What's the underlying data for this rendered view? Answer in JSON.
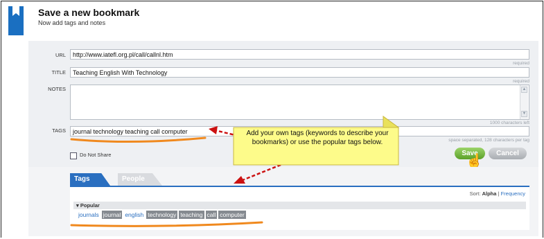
{
  "header": {
    "title": "Save a new bookmark",
    "subtitle": "Now add tags and notes"
  },
  "form": {
    "url": {
      "label": "URL",
      "value": "http://www.iatefl.org.pl/call/callnl.htm",
      "hint": "required"
    },
    "title": {
      "label": "TITLE",
      "value": "Teaching English With Technology",
      "hint": "required"
    },
    "notes": {
      "label": "NOTES",
      "value": "",
      "hint": "1000 characters left"
    },
    "tags": {
      "label": "TAGS",
      "value": "journal technology teaching call computer",
      "hint": "space separated, 128 characters per tag"
    },
    "do_not_share": {
      "label": "Do Not Share",
      "checked": false
    },
    "save_label": "Save",
    "cancel_label": "Cancel"
  },
  "tabs": [
    {
      "label": "Tags",
      "active": true
    },
    {
      "label": "People",
      "active": false
    }
  ],
  "sort": {
    "prefix": "Sort:",
    "alpha": "Alpha",
    "separator": "|",
    "frequency": "Frequency"
  },
  "popular": {
    "heading": "Popular",
    "tags": [
      {
        "label": "journals",
        "selected": false
      },
      {
        "label": "journal",
        "selected": true
      },
      {
        "label": "english",
        "selected": false
      },
      {
        "label": "technology",
        "selected": true
      },
      {
        "label": "teaching",
        "selected": true
      },
      {
        "label": "call",
        "selected": true
      },
      {
        "label": "computer",
        "selected": true
      }
    ]
  },
  "callout": {
    "text": "Add your own tags (keywords to describe your bookmarks) or use the popular tags below."
  },
  "colors": {
    "accent": "#2a6fc0",
    "save": "#6cb33a",
    "callout_fill": "#fdfb8a",
    "annotation_arrow": "#cc1111",
    "underline": "#f0891e"
  },
  "icons": {
    "logo": "bookmark-icon",
    "scroll_up": "scroll-up-icon",
    "scroll_down": "scroll-down-icon",
    "cursor": "hand-cursor-icon",
    "popular_toggle": "triangle-down-icon"
  }
}
